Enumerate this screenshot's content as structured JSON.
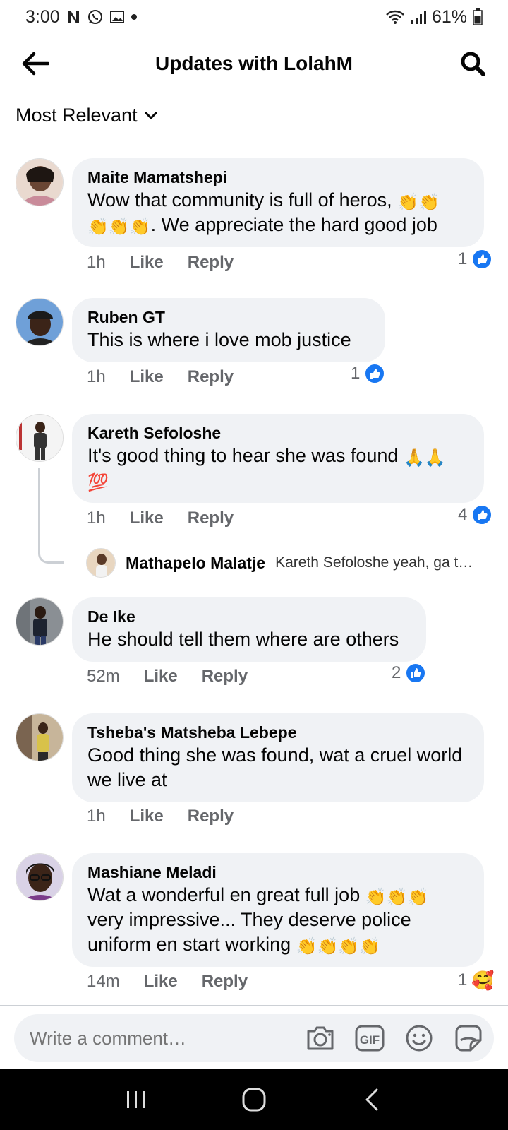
{
  "status_bar": {
    "time": "3:00",
    "battery": "61%"
  },
  "header": {
    "title": "Updates with LolahM"
  },
  "sort": {
    "label": "Most Relevant"
  },
  "actions": {
    "like": "Like",
    "reply": "Reply"
  },
  "comments": [
    {
      "author": "Maite Mamatshepi",
      "text_a": "Wow that community is full of heros, ",
      "text_b": ". We appreciate the hard good job",
      "time": "1h",
      "likes": "1"
    },
    {
      "author": "Ruben GT",
      "text": "This is where i love mob justice",
      "time": "1h",
      "likes": "1"
    },
    {
      "author": "Kareth Sefoloshe",
      "text": "It's good thing to hear  she was found ",
      "time": "1h",
      "likes": "4",
      "reply_preview": {
        "author": "Mathapelo Malatje",
        "text": "Kareth Sefoloshe yeah, ga t…"
      }
    },
    {
      "author": "De Ike",
      "text": "He should tell them where are others",
      "time": "52m",
      "likes": "2"
    },
    {
      "author": "Tsheba's Matsheba Lebepe",
      "text": "Good thing she was found, wat a cruel world we live at",
      "time": "1h"
    },
    {
      "author": "Mashiane Meladi",
      "text_a": "Wat a wonderful en great full job ",
      "text_b": "very impressive... They deserve police uniform  en start working ",
      "time": "14m",
      "likes": "1"
    }
  ],
  "composer": {
    "placeholder": "Write a comment…",
    "gif_label": "GIF"
  },
  "colors": {
    "brand_blue": "#1877f2",
    "bubble_bg": "#f0f2f5",
    "meta_gray": "#65676b"
  }
}
